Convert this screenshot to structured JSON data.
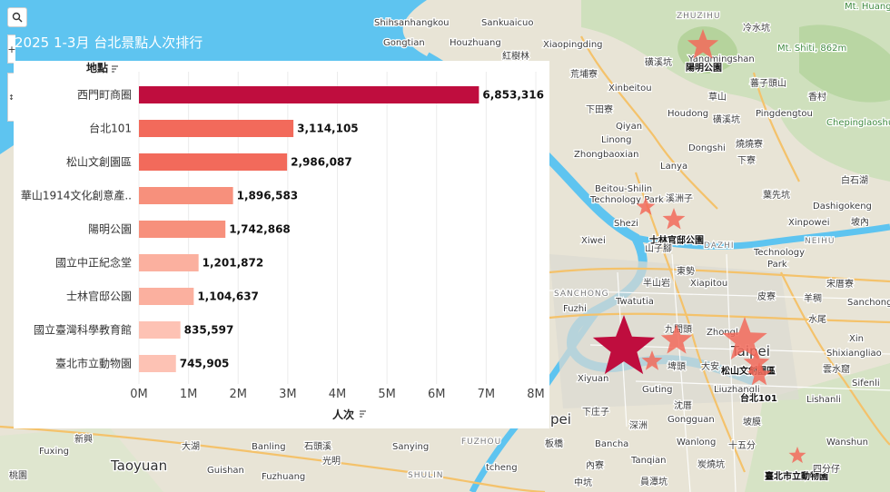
{
  "toolbar": {
    "search_icon": "search-icon",
    "zoom_in_label": "+",
    "pan_label": "↕"
  },
  "title": "2025 1-3月 台北景點人次排行",
  "chart_data": {
    "type": "bar",
    "orientation": "horizontal",
    "title": "2025 1-3月 台北景點人次排行",
    "ylabel": "地點",
    "xlabel": "人次",
    "sort_icon": "sort-descending-icon",
    "categories": [
      "西門町商圈",
      "台北101",
      "松山文創園區",
      "華山1914文化創意產..",
      "陽明公園",
      "國立中正紀念堂",
      "士林官邸公園",
      "國立臺灣科學教育館",
      "臺北市立動物園"
    ],
    "values": [
      6853316,
      3114105,
      2986087,
      1896583,
      1742868,
      1201872,
      1104637,
      835597,
      745905
    ],
    "value_labels": [
      "6,853,316",
      "3,114,105",
      "2,986,087",
      "1,896,583",
      "1,742,868",
      "1,201,872",
      "1,104,637",
      "835,597",
      "745,905"
    ],
    "xlim": [
      0,
      8000000
    ],
    "xticks": [
      0,
      1000000,
      2000000,
      3000000,
      4000000,
      5000000,
      6000000,
      7000000,
      8000000
    ],
    "xtick_labels": [
      "0M",
      "1M",
      "2M",
      "3M",
      "4M",
      "5M",
      "6M",
      "7M",
      "8M"
    ],
    "grid": true,
    "colors": [
      "#bf0d3e",
      "#f26a5b",
      "#f26a5b",
      "#f7907c",
      "#f7907c",
      "#fbb09f",
      "#fbb09f",
      "#fdc2b4",
      "#fdc2b4"
    ]
  },
  "map": {
    "labels": [
      "Shihsanhangkou",
      "Sankuaicuo",
      "ZHUZIHU",
      "Mt. Huangzui",
      "Gongtian",
      "Houzhuang",
      "冷水坑",
      "Xiaopingding",
      "Yangmingshan",
      "Mt. Shiti, 862m",
      "紅樹林",
      "荒埔寮",
      "陽明公園",
      "磺溪坑",
      "Xinbeitou",
      "草山",
      "蕃子頭山",
      "香村",
      "下田寮",
      "Houdong",
      "Pingdengtou",
      "Qiyan",
      "Linong",
      "Dongshi",
      "燒燒寮",
      "Zhongbaoxian",
      "Lanya",
      "Beitou-Shilin Technology Park",
      "溪洲子",
      "葉先坑",
      "Shezi",
      "Xinpowei",
      "士林官邸公園",
      "Xiwei",
      "DAZHI",
      "NEIHU",
      "Technology Park",
      "東勢",
      "SANCHONG",
      "半山岩",
      "Xiapitou",
      "宋厝寮",
      "Twatutia",
      "皮寮",
      "Fuzhi",
      "九間頭",
      "Zhongl",
      "Taipei",
      "Xiyuan",
      "埤頭",
      "大安",
      "松山文創園區",
      "Guting",
      "Liuzhangli",
      "台北101",
      "Gongguan",
      "沈厝",
      "Shuangxi",
      "Taoyuan",
      "Guishan",
      "新興",
      "Fuxing",
      "Banling",
      "Sanying",
      "FUZHOU",
      "SHULIN",
      "深洲",
      "Wanshun",
      "Sanxia",
      "臺北市立動物園",
      "Chepinglaoshu",
      "Lishanli",
      "十五分",
      "Tanxin",
      "Songshan",
      "Sanchong",
      "Keng"
    ],
    "star_colors": {
      "top": "#bf0d3e",
      "other": "#f26a5b"
    }
  }
}
